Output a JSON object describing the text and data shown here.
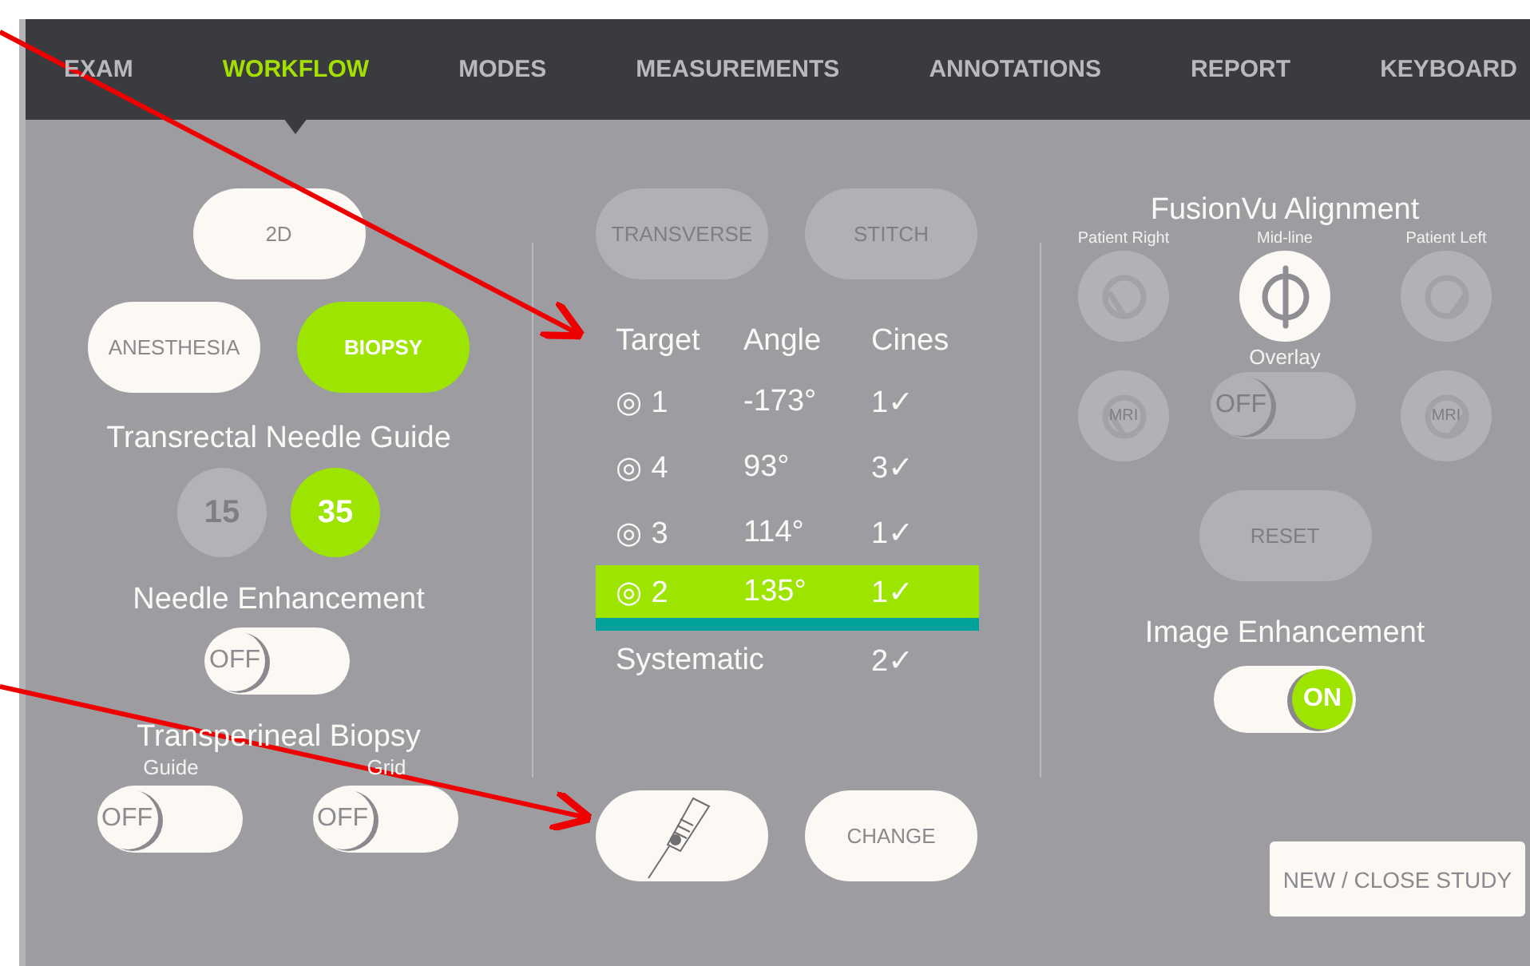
{
  "tabs": [
    {
      "label": "EXAM",
      "selected": false
    },
    {
      "label": "WORKFLOW",
      "selected": true
    },
    {
      "label": "MODES",
      "selected": false
    },
    {
      "label": "MEASUREMENTS",
      "selected": false
    },
    {
      "label": "ANNOTATIONS",
      "selected": false
    },
    {
      "label": "REPORT",
      "selected": false
    },
    {
      "label": "KEYBOARD",
      "selected": false
    }
  ],
  "left": {
    "mode_button": {
      "label": "2D",
      "selected": false
    },
    "procedure_buttons": [
      {
        "label": "ANESTHESIA",
        "selected": false
      },
      {
        "label": "BIOPSY",
        "selected": true
      }
    ],
    "needle_guide": {
      "title": "Transrectal Needle Guide",
      "options": [
        {
          "label": "15",
          "selected": false
        },
        {
          "label": "35",
          "selected": true
        }
      ]
    },
    "needle_enhancement": {
      "title": "Needle Enhancement",
      "toggle": {
        "text": "OFF",
        "on": false
      }
    },
    "transperineal": {
      "title": "Transperineal Biopsy",
      "toggles": [
        {
          "label": "Guide",
          "text": "OFF",
          "on": false
        },
        {
          "label": "Grid",
          "text": "OFF",
          "on": false
        }
      ]
    }
  },
  "middle": {
    "buttons": [
      {
        "label": "TRANSVERSE",
        "disabled": true
      },
      {
        "label": "STITCH",
        "disabled": true
      }
    ],
    "table": {
      "columns": [
        "Target",
        "Angle",
        "Cines"
      ],
      "rows": [
        {
          "symbol": "◎",
          "target": "1",
          "angle": "-173°",
          "cines": "1✓",
          "selected": false
        },
        {
          "symbol": "◎",
          "target": "4",
          "angle": "93°",
          "cines": "3✓",
          "selected": false
        },
        {
          "symbol": "◎",
          "target": "3",
          "angle": "114°",
          "cines": "1✓",
          "selected": false
        },
        {
          "symbol": "◎",
          "target": "2",
          "angle": "135°",
          "cines": "1✓",
          "selected": true
        }
      ],
      "summary": {
        "label": "Systematic",
        "cines": "2✓"
      }
    },
    "change_button": {
      "label": "CHANGE"
    }
  },
  "right": {
    "title": "FusionVu Alignment",
    "positions": [
      {
        "label": "Patient Right",
        "kind": "right",
        "selected": false
      },
      {
        "label": "Mid-line",
        "kind": "mid",
        "selected": true
      },
      {
        "label": "Patient Left",
        "kind": "left",
        "selected": false
      }
    ],
    "mri_buttons": [
      {
        "text": "MRI",
        "kind": "right",
        "disabled": true
      },
      {
        "text": "MRI",
        "kind": "left",
        "disabled": true
      }
    ],
    "overlay": {
      "label": "Overlay",
      "text": "OFF",
      "on": false,
      "disabled": true
    },
    "reset": {
      "label": "RESET",
      "disabled": true
    },
    "image_enhancement": {
      "title": "Image Enhancement",
      "toggle": {
        "text": "ON",
        "on": true
      }
    },
    "study_button": {
      "label": "NEW / CLOSE STUDY"
    }
  }
}
